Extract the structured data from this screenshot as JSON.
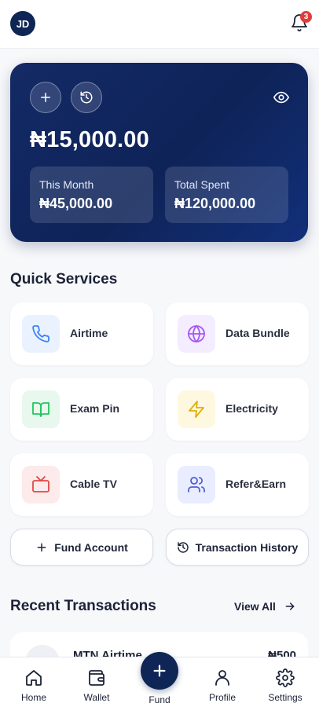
{
  "header": {
    "avatar_initials": "JD",
    "notification_count": "3"
  },
  "balance_card": {
    "balance": "₦15,000.00",
    "stats": [
      {
        "label": "This Month",
        "value": "₦45,000.00"
      },
      {
        "label": "Total Spent",
        "value": "₦120,000.00"
      }
    ],
    "gradient_colors": [
      "#142a66",
      "#0e2358",
      "#12307a"
    ]
  },
  "quick_services": {
    "title": "Quick Services",
    "items": [
      {
        "label": "Airtime",
        "icon": "phone-icon",
        "tint": "#eaf2ff",
        "color": "#3b82f6"
      },
      {
        "label": "Data Bundle",
        "icon": "globe-icon",
        "tint": "#f4ecff",
        "color": "#a855f7"
      },
      {
        "label": "Exam Pin",
        "icon": "book-icon",
        "tint": "#e8f8ee",
        "color": "#22c55e"
      },
      {
        "label": "Electricity",
        "icon": "lightning-icon",
        "tint": "#fff8e0",
        "color": "#e0b000"
      },
      {
        "label": "Cable TV",
        "icon": "tv-icon",
        "tint": "#fdeaea",
        "color": "#e04848"
      },
      {
        "label": "Refer&Earn",
        "icon": "users-icon",
        "tint": "#eaedff",
        "color": "#4f5fd0"
      }
    ]
  },
  "actions": {
    "fund_account": "Fund Account",
    "transaction_history": "Transaction History"
  },
  "recent": {
    "title": "Recent Transactions",
    "view_all": "View All",
    "items": [
      {
        "name": "MTN Airtime",
        "amount": "₦500"
      }
    ]
  },
  "nav": {
    "home": "Home",
    "wallet": "Wallet",
    "fund": "Fund",
    "profile": "Profile",
    "settings": "Settings"
  },
  "colors": {
    "brand_navy": "#0f2555",
    "badge_red": "#e23b3b"
  }
}
